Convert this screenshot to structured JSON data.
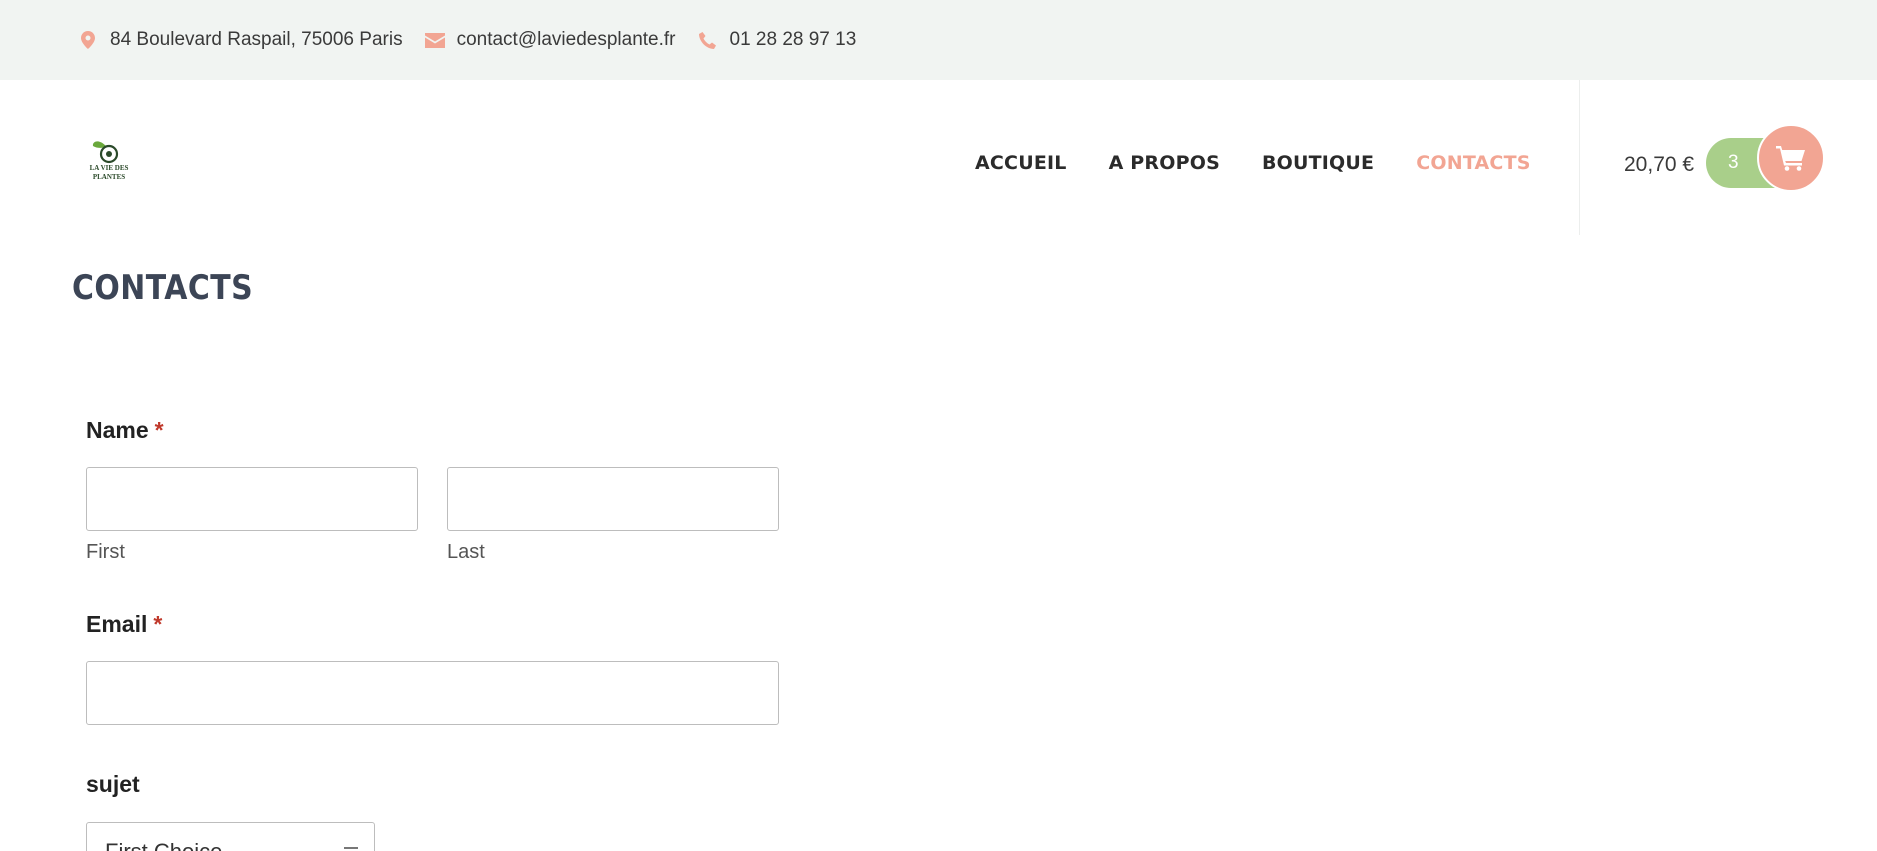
{
  "topbar": {
    "address": "84 Boulevard Raspail, 75006 Paris",
    "email": "contact@laviedesplante.fr",
    "phone": "01 28 28 97 13"
  },
  "header": {
    "logo_text": "LA VIE DES PLANTES",
    "nav": [
      "ACCUEIL",
      "A PROPOS",
      "BOUTIQUE",
      "CONTACTS"
    ],
    "active_nav": "CONTACTS",
    "cart_total": "20,70 €",
    "cart_count": "3"
  },
  "page": {
    "title": "CONTACTS"
  },
  "form": {
    "name_label": "Name",
    "required_mark": "*",
    "first_sublabel": "First",
    "last_sublabel": "Last",
    "first_value": "",
    "last_value": "",
    "email_label": "Email",
    "email_value": "",
    "subject_label": "sujet",
    "subject_selected": "First Choice"
  },
  "colors": {
    "accent": "#f2a593",
    "cart_pill": "#a9cf8a",
    "topbar_bg": "#f1f4f2",
    "title": "#3c4556"
  }
}
